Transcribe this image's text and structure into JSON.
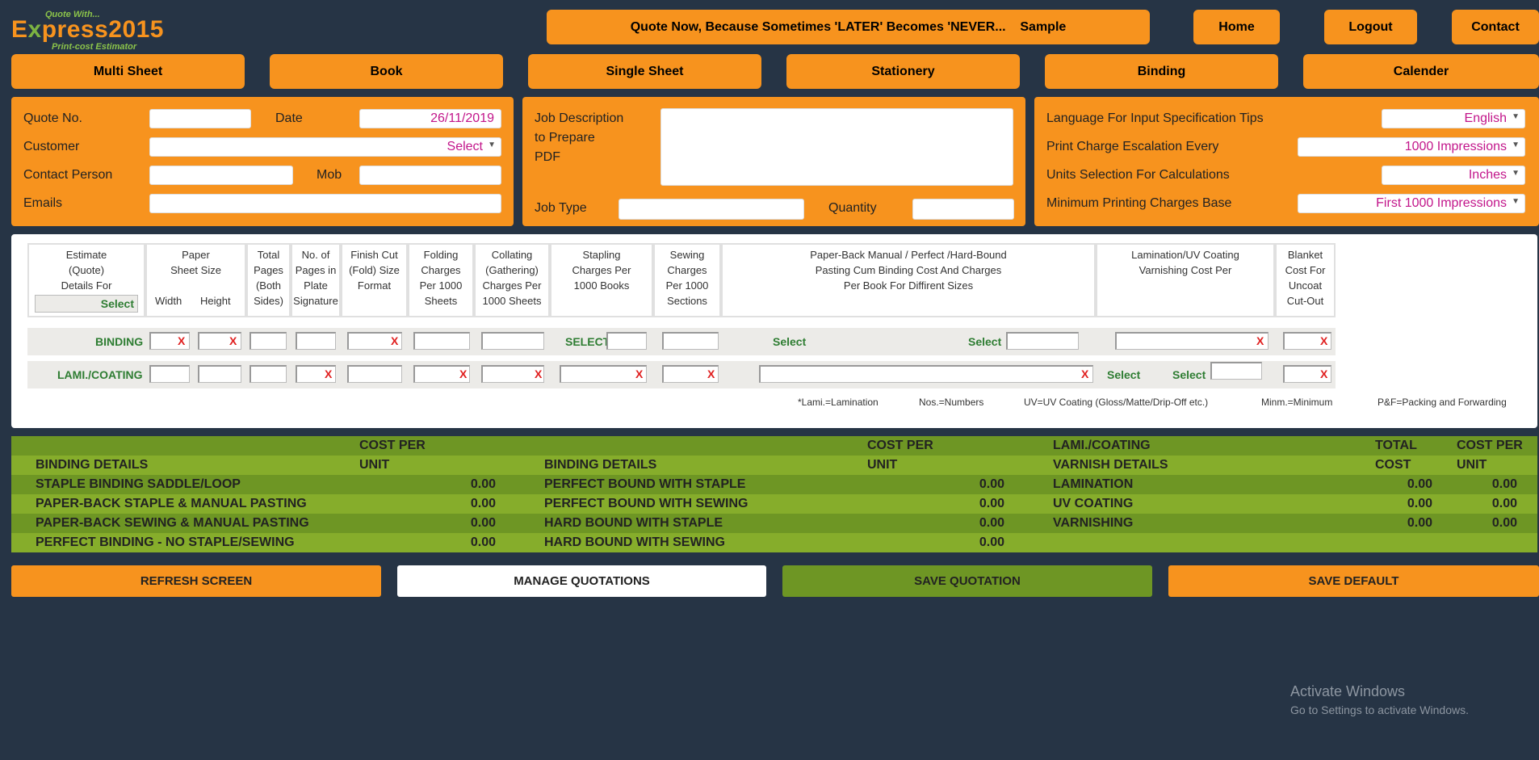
{
  "logo": {
    "small": "Quote With...",
    "brand_e": "E",
    "brand_x": "x",
    "brand_rest": "press2015",
    "sub": "Print-cost Estimator"
  },
  "header": {
    "marquee": "Quote Now, Because Sometimes 'LATER' Becomes 'NEVER...    Sample",
    "home": "Home",
    "logout": "Logout",
    "contact": "Contact"
  },
  "tabs": [
    "Multi Sheet",
    "Book",
    "Single Sheet",
    "Stationery",
    "Binding",
    "Calender"
  ],
  "form1": {
    "quote_no": "Quote No.",
    "date": "Date",
    "date_value": "26/11/2019",
    "customer": "Customer",
    "customer_value": "Select",
    "contact_person": "Contact Person",
    "mob": "Mob",
    "emails": "Emails"
  },
  "form2": {
    "job_desc": "Job Description",
    "to_prepare": "to Prepare",
    "pdf": "PDF",
    "job_type": "Job Type",
    "quantity": "Quantity"
  },
  "form3": {
    "language": "Language For Input Specification Tips",
    "language_value": "English",
    "escalation": "Print Charge Escalation Every",
    "escalation_value": "1000 Impressions",
    "units": "Units Selection For Calculations",
    "units_value": "Inches",
    "min_base": "Minimum Printing Charges Base",
    "min_base_value": "First 1000 Impressions"
  },
  "table": {
    "col_estimate": [
      "Estimate",
      "(Quote)",
      "Details For"
    ],
    "estimate_select": "Select",
    "col_paper": [
      "Paper",
      "Sheet Size"
    ],
    "width": "Width",
    "height": "Height",
    "col_total": [
      "Total",
      "Pages",
      "(Both",
      "Sides)"
    ],
    "col_pages": [
      "No. of",
      "Pages in",
      "Plate",
      "Signature"
    ],
    "col_finish": [
      "Finish Cut",
      "(Fold) Size",
      "Format"
    ],
    "col_folding": [
      "Folding",
      "Charges",
      "Per 1000",
      "Sheets"
    ],
    "col_collating": [
      "Collating",
      "(Gathering)",
      "Charges Per",
      "1000 Sheets"
    ],
    "col_stapling": [
      "Stapling",
      "Charges Per",
      "1000 Books"
    ],
    "col_sewing": [
      "Sewing",
      "Charges",
      "Per 1000",
      "Sections"
    ],
    "col_binding": [
      "Paper-Back Manual / Perfect /Hard-Bound",
      "Pasting Cum Binding Cost And Charges",
      "Per Book For Diffirent Sizes"
    ],
    "col_lamination": [
      "Lamination/UV Coating",
      "Varnishing Cost Per"
    ],
    "col_blanket": [
      "Blanket",
      "Cost For",
      "Uncoat",
      "Cut-Out"
    ],
    "row_binding": "BINDING",
    "row_lami": "LAMI./COATING",
    "select_caps": "SELECT",
    "select": "Select",
    "x": "X"
  },
  "legend": {
    "lami": "*Lami.=Lamination",
    "nos": "Nos.=Numbers",
    "uv": "UV=UV Coating (Gloss/Matte/Drip-Off etc.)",
    "minm": "Minm.=Minimum",
    "pf": "P&F=Packing and Forwarding"
  },
  "summary": {
    "cost_per": "COST PER",
    "unit": "UNIT",
    "total": "TOTAL",
    "cost": "COST",
    "binding_details": "BINDING DETAILS",
    "lami_coating": "LAMI./COATING",
    "varnish_details": "VARNISH DETAILS",
    "col1": [
      {
        "label": "STAPLE BINDING SADDLE/LOOP",
        "value": "0.00"
      },
      {
        "label": "PAPER-BACK STAPLE & MANUAL PASTING",
        "value": "0.00"
      },
      {
        "label": "PAPER-BACK SEWING & MANUAL PASTING",
        "value": "0.00"
      },
      {
        "label": "PERFECT BINDING - NO STAPLE/SEWING",
        "value": "0.00"
      }
    ],
    "col2": [
      {
        "label": "PERFECT BOUND WITH STAPLE",
        "value": "0.00"
      },
      {
        "label": "PERFECT BOUND WITH SEWING",
        "value": "0.00"
      },
      {
        "label": "HARD BOUND WITH STAPLE",
        "value": "0.00"
      },
      {
        "label": "HARD BOUND WITH SEWING",
        "value": "0.00"
      }
    ],
    "col3": [
      {
        "label": "LAMINATION",
        "total": "0.00",
        "unit": "0.00"
      },
      {
        "label": "UV COATING",
        "total": "0.00",
        "unit": "0.00"
      },
      {
        "label": "VARNISHING",
        "total": "0.00",
        "unit": "0.00"
      }
    ]
  },
  "buttons": {
    "refresh": "REFRESH SCREEN",
    "manage": "MANAGE QUOTATIONS",
    "save": "SAVE QUOTATION",
    "default": "SAVE DEFAULT"
  },
  "watermark": {
    "line1": "Activate Windows",
    "line2": "Go to Settings to activate Windows."
  },
  "colors": {
    "orange": "#f7931e",
    "green_dark": "#6e9624",
    "green_light": "#86ad2b",
    "bg": "#263445",
    "magenta": "#c2158a"
  }
}
